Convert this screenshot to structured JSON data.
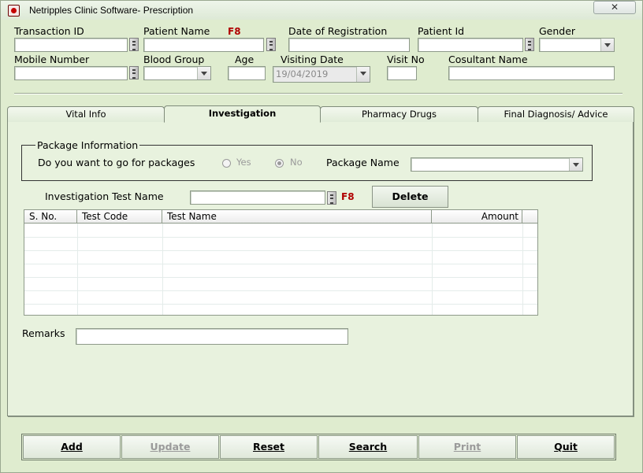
{
  "window": {
    "title": "Netripples Clinic Software- Prescription",
    "close_glyph": "✕"
  },
  "fields": {
    "transaction_id": {
      "label": "Transaction ID",
      "value": ""
    },
    "patient_name": {
      "label": "Patient Name",
      "hotkey": "F8",
      "value": ""
    },
    "date_of_registration": {
      "label": "Date of Registration",
      "value": ""
    },
    "patient_id": {
      "label": "Patient Id",
      "value": ""
    },
    "gender": {
      "label": "Gender",
      "value": ""
    },
    "mobile_number": {
      "label": "Mobile Number",
      "value": ""
    },
    "blood_group": {
      "label": "Blood Group",
      "value": ""
    },
    "age": {
      "label": "Age",
      "value": ""
    },
    "visiting_date": {
      "label": "Visiting Date",
      "value": "19/04/2019"
    },
    "visit_no": {
      "label": "Visit No",
      "value": ""
    },
    "consultant_name": {
      "label": "Cosultant Name",
      "value": ""
    }
  },
  "tabs": [
    {
      "label": "Vital Info",
      "active": false
    },
    {
      "label": "Investigation",
      "active": true
    },
    {
      "label": "Pharmacy Drugs",
      "active": false
    },
    {
      "label": "Final Diagnosis/ Advice",
      "active": false
    }
  ],
  "package": {
    "group_title": "Package Information",
    "question": "Do you want to go for packages",
    "option_yes": "Yes",
    "option_no": "No",
    "selected": "No",
    "package_name_label": "Package Name",
    "package_name_value": ""
  },
  "investigation": {
    "label": "Investigation Test Name",
    "hotkey": "F8",
    "value": "",
    "delete_label": "Delete"
  },
  "grid": {
    "columns": [
      "S. No.",
      "Test Code",
      "Test Name",
      "Amount"
    ],
    "rows": []
  },
  "remarks": {
    "label": "Remarks",
    "value": ""
  },
  "buttons": [
    {
      "label": "Add",
      "enabled": true
    },
    {
      "label": "Update",
      "enabled": false
    },
    {
      "label": "Reset",
      "enabled": true
    },
    {
      "label": "Search",
      "enabled": true
    },
    {
      "label": "Print",
      "enabled": false
    },
    {
      "label": "Quit",
      "enabled": true
    }
  ]
}
